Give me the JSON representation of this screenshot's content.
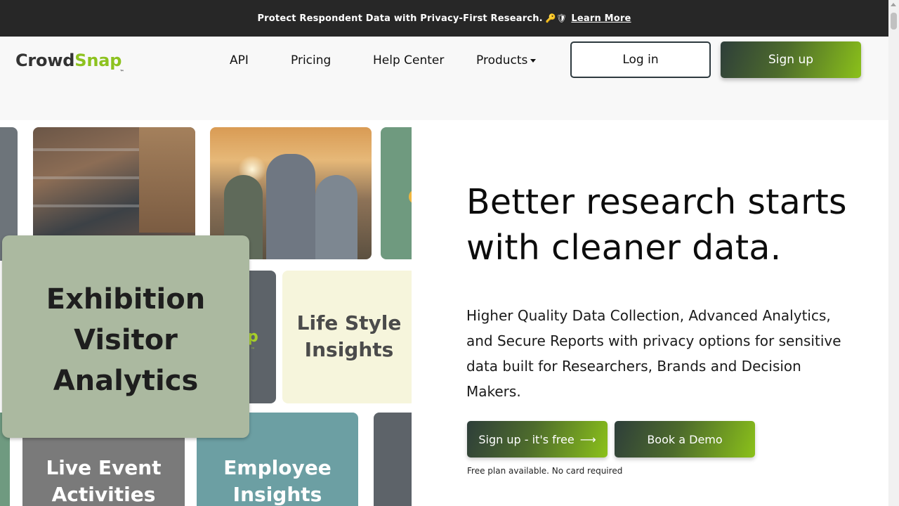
{
  "banner": {
    "text": "Protect Respondent Data with Privacy-First Research.",
    "emoji": "🔑🛡",
    "link_label": "Learn More"
  },
  "logo": {
    "part1": "Crowd",
    "part2": "Snap",
    "tm": "™"
  },
  "nav": {
    "api": "API",
    "pricing": "Pricing",
    "help_center": "Help Center",
    "products": "Products",
    "login": "Log in",
    "signup": "Sign up"
  },
  "collage": {
    "exhibition_line1": "Exhibition",
    "exhibition_line2": "Visitor",
    "exhibition_line3": "Analytics",
    "lifestyle_line1": "Life Style",
    "lifestyle_line2": "Insights",
    "live_line1": "Live Event",
    "live_line2": "Activities",
    "employee_line1": "Employee",
    "employee_line2": "Insights",
    "logo_fragment": "p",
    "logo_fragment_tm": "™"
  },
  "hero": {
    "title_line1": "Better research starts",
    "title_line2": "with cleaner data.",
    "description": "Higher Quality Data Collection, Advanced Analytics, and Secure Reports with privacy options for sensitive data built for Researchers, Brands and Decision Makers.",
    "cta_signup": "Sign up - it's free",
    "cta_arrow": "⟶",
    "cta_demo": "Book a Demo",
    "note": "Free plan available. No card required"
  },
  "colors": {
    "accent_green": "#8dc21f",
    "banner_bg": "#272727",
    "gradient_dark": "#2e3e3a"
  }
}
